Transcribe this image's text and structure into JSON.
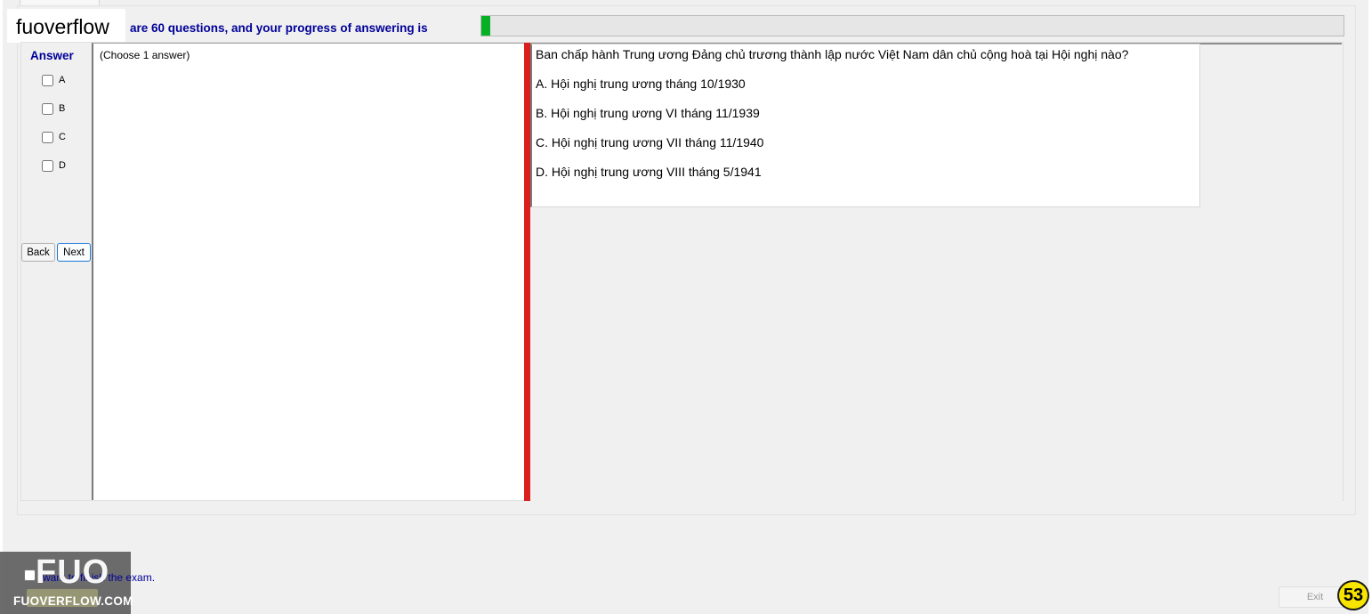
{
  "header": {
    "progress_text": "are 60 questions, and your progress of answering is",
    "progress_fraction": 0.01,
    "progress_color": "#06b025",
    "logo_text": "fuoverflow"
  },
  "answer_panel": {
    "heading": "Answer",
    "options": [
      "A",
      "B",
      "C",
      "D"
    ],
    "back_label": "Back",
    "next_label": "Next"
  },
  "choose_hint": "(Choose 1 answer)",
  "question": {
    "text": "Ban chấp hành Trung ương Đảng chủ trương thành lập nước Việt Nam dân chủ cộng hoà tại Hội nghị nào?",
    "choices": [
      "A.  Hội nghị trung ương tháng 10/1930",
      "B.  Hội nghị trung ương VI tháng 11/1939",
      "C.  Hội nghị trung ương VII tháng 11/1940",
      "D.  Hội nghị trung ương VIII tháng 5/1941"
    ]
  },
  "footer": {
    "finish_text": "want to finish the exam.",
    "watermark_big": "FUO",
    "watermark_small": "FUOVERFLOW.COM",
    "exit_label": "Exit",
    "counter": "53",
    "counter_color": "#f7e400"
  },
  "colors": {
    "heading_blue": "#000099",
    "divider_red": "#d9201f"
  }
}
